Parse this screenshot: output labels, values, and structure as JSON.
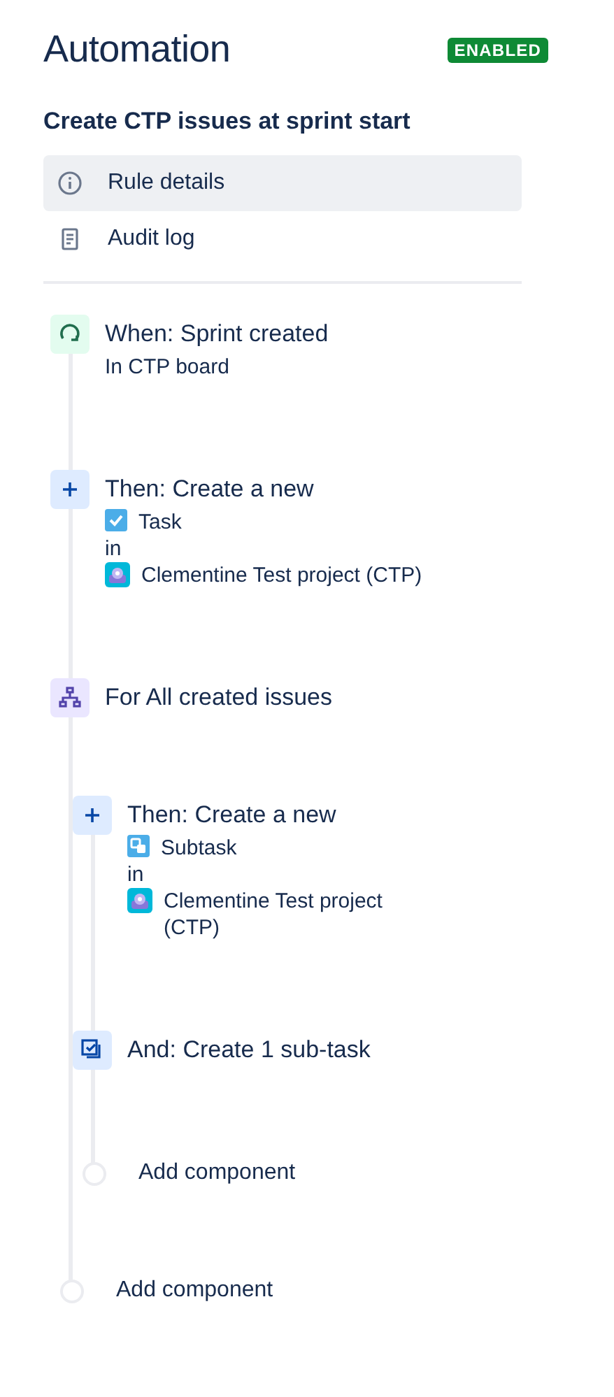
{
  "header": {
    "title": "Automation",
    "status": "ENABLED"
  },
  "rule_name": "Create CTP issues at sprint start",
  "menu": [
    {
      "label": "Rule details",
      "kind": "info",
      "selected": true
    },
    {
      "label": "Audit log",
      "kind": "log",
      "selected": false
    }
  ],
  "flow": [
    {
      "kind": "trigger",
      "title": "When: Sprint created",
      "details": [
        {
          "kind": "text",
          "text": "In CTP board"
        }
      ]
    },
    {
      "kind": "action",
      "title": "Then: Create a new",
      "details": [
        {
          "kind": "task",
          "text": "Task"
        },
        {
          "kind": "text",
          "text": "in"
        },
        {
          "kind": "project",
          "text": "Clementine Test project (CTP)"
        }
      ]
    },
    {
      "kind": "branch",
      "title": "For All created issues",
      "children": [
        {
          "kind": "action",
          "title": "Then: Create a new",
          "details": [
            {
              "kind": "subtask",
              "text": "Subtask"
            },
            {
              "kind": "text",
              "text": "in"
            },
            {
              "kind": "project",
              "text": "Clementine Test project (CTP)"
            }
          ]
        },
        {
          "kind": "subtask_action",
          "title": "And: Create 1 sub-task"
        },
        {
          "kind": "add",
          "title": "Add component"
        }
      ]
    },
    {
      "kind": "add",
      "title": "Add component"
    }
  ]
}
